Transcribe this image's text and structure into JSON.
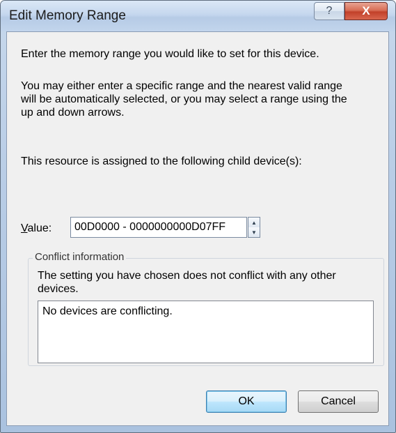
{
  "dialog": {
    "title": "Edit Memory Range",
    "help_glyph": "?",
    "close_glyph": "X",
    "intro": "Enter the memory range you would like to set for this device.",
    "desc_line1": "You may either enter a specific range and the nearest valid range",
    "desc_line2": "will be automatically selected, or you may select a range using the",
    "desc_line3": "up and down arrows.",
    "assigned": "This resource is assigned to the following child device(s):",
    "value_label_access": "V",
    "value_label_rest": "alue:",
    "value": "00D0000 - 0000000000D07FF",
    "spin_up_glyph": "▲",
    "spin_down_glyph": "▼",
    "conflict_group_title": "Conflict information",
    "conflict_message": "The setting you have chosen does not conflict with any other devices.",
    "conflict_list_text": "No devices are conflicting.",
    "ok_label": "OK",
    "cancel_label": "Cancel"
  }
}
